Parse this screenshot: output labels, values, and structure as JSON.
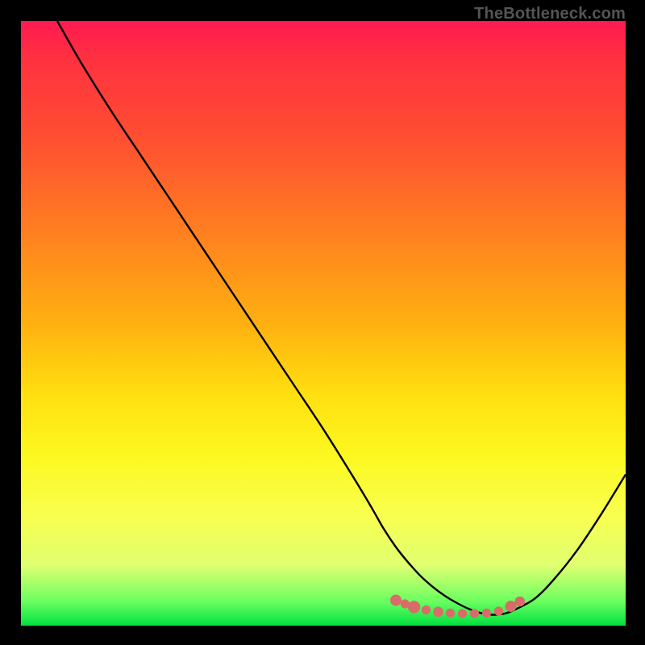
{
  "watermark": "TheBottleneck.com",
  "chart_data": {
    "type": "line",
    "title": "",
    "xlabel": "",
    "ylabel": "",
    "xlim": [
      0,
      100
    ],
    "ylim": [
      0,
      100
    ],
    "grid": false,
    "series": [
      {
        "name": "bottleneck-curve",
        "x": [
          6,
          10,
          15,
          20,
          25,
          30,
          35,
          40,
          45,
          50,
          55,
          58,
          60,
          62,
          64,
          66,
          68,
          70,
          72,
          74,
          76,
          78,
          80,
          82,
          85,
          88,
          92,
          96,
          100
        ],
        "y": [
          100,
          93,
          85,
          77.5,
          70,
          62.5,
          55,
          47.5,
          40,
          32.5,
          24.5,
          19.5,
          16,
          13,
          10.5,
          8.3,
          6.5,
          5,
          3.8,
          2.8,
          2.1,
          1.8,
          2.0,
          2.8,
          4.5,
          7.5,
          12.5,
          18.5,
          25
        ]
      }
    ],
    "markers": {
      "name": "bottleneck-dots",
      "color": "#d96b6b",
      "points": [
        {
          "x": 62,
          "y": 4.2,
          "r": 1.0
        },
        {
          "x": 63.5,
          "y": 3.6,
          "r": 0.8
        },
        {
          "x": 65,
          "y": 3.1,
          "r": 1.1
        },
        {
          "x": 67,
          "y": 2.6,
          "r": 0.8
        },
        {
          "x": 69,
          "y": 2.3,
          "r": 0.9
        },
        {
          "x": 71,
          "y": 2.1,
          "r": 0.8
        },
        {
          "x": 73,
          "y": 2.0,
          "r": 0.8
        },
        {
          "x": 75,
          "y": 2.0,
          "r": 0.8
        },
        {
          "x": 77,
          "y": 2.1,
          "r": 0.8
        },
        {
          "x": 79,
          "y": 2.4,
          "r": 0.8
        },
        {
          "x": 81,
          "y": 3.2,
          "r": 1.0
        },
        {
          "x": 82.5,
          "y": 4.0,
          "r": 0.9
        }
      ]
    },
    "gradient_stops": [
      {
        "pos": 0.0,
        "color": "#ff1a50"
      },
      {
        "pos": 0.2,
        "color": "#ff5030"
      },
      {
        "pos": 0.5,
        "color": "#ffb010"
      },
      {
        "pos": 0.72,
        "color": "#fcf820"
      },
      {
        "pos": 0.9,
        "color": "#e0ff70"
      },
      {
        "pos": 1.0,
        "color": "#00e040"
      }
    ]
  }
}
